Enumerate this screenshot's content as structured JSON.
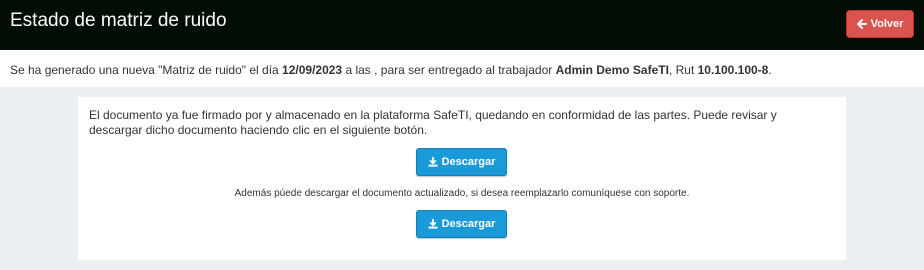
{
  "header": {
    "title": "Estado de matriz de ruido",
    "back_label": "Volver",
    "back_icon": "arrow-left-icon",
    "back_color": "#d9534f",
    "bar_color": "#020d04"
  },
  "info": {
    "prefix": "Se ha generado una nueva \"Matriz de ruido\" el día ",
    "date": "12/09/2023",
    "middle": " a las , para ser entregado al trabajador ",
    "worker": "Admin Demo SafeTI",
    "rut_prefix": ", Rut ",
    "rut": "10.100.100-8",
    "suffix": "."
  },
  "card": {
    "message": "El documento ya fue firmado por y almacenado en la plataforma SafeTI, quedando en conformidad de las partes. Puede revisar y descargar dicho documento haciendo clic en el siguiente botón.",
    "download_label": "Descargar",
    "download_icon": "download-icon",
    "note": "Además púede descargar el documento actualizado, si desea reemplazarlo comuníquese con soporte.",
    "download2_label": "Descargar",
    "button_color": "#1a9ad9"
  }
}
